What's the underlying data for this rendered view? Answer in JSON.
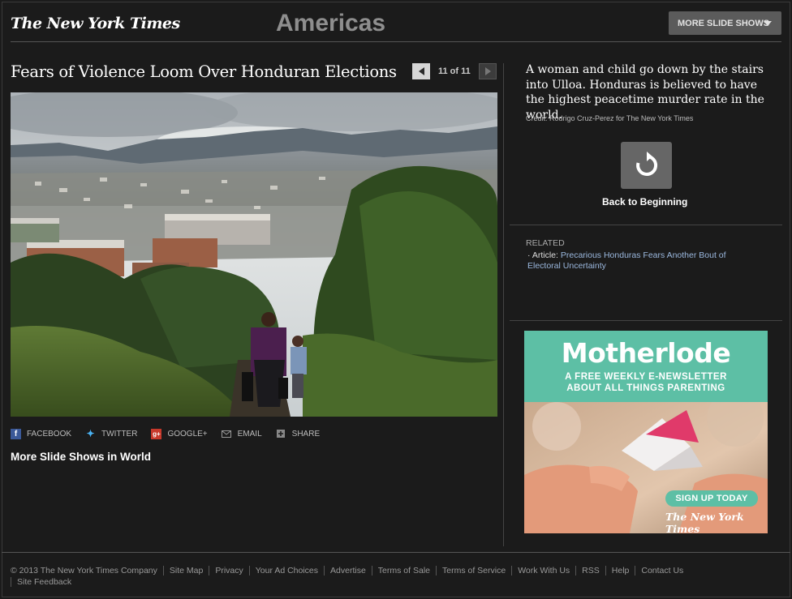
{
  "header": {
    "logo": "The New York Times",
    "section": "Americas",
    "more_button": "MORE SLIDE SHOWS"
  },
  "slideshow": {
    "headline": "Fears of Violence Loom Over Honduran Elections",
    "counter": "11 of 11",
    "photo_alt": "photo",
    "caption": "A woman and child go down by the stairs into Ulloa. Honduras is believed to have the highest peacetime murder rate in the world.",
    "credit": "Credit: Rodrigo Cruz-Perez for The New York Times",
    "back_label": "Back to Beginning"
  },
  "share": {
    "facebook": "FACEBOOK",
    "twitter": "TWITTER",
    "google": "GOOGLE+",
    "email": "EMAIL",
    "share": "SHARE"
  },
  "more_link": "More Slide Shows in World",
  "related": {
    "heading": "RELATED",
    "prefix": "Article:",
    "link": "Precarious Honduras Fears Another Bout of Electoral Uncertainty"
  },
  "ad": {
    "title": "Motherlode",
    "line1": "A FREE WEEKLY E-NEWSLETTER",
    "line2": "ABOUT ALL THINGS PARENTING",
    "cta": "SIGN UP TODAY",
    "logo": "The New York Times"
  },
  "footer": {
    "copyright": "© 2013 The New York Times Company",
    "links": [
      "Site Map",
      "Privacy",
      "Your Ad Choices",
      "Advertise",
      "Terms of Sale",
      "Terms of Service",
      "Work With Us",
      "RSS",
      "Help",
      "Contact Us",
      "Site Feedback"
    ]
  },
  "colors": {
    "background": "#1b1b1b",
    "link_blue": "#9bb8de",
    "ad_teal": "#5dbfa5"
  }
}
